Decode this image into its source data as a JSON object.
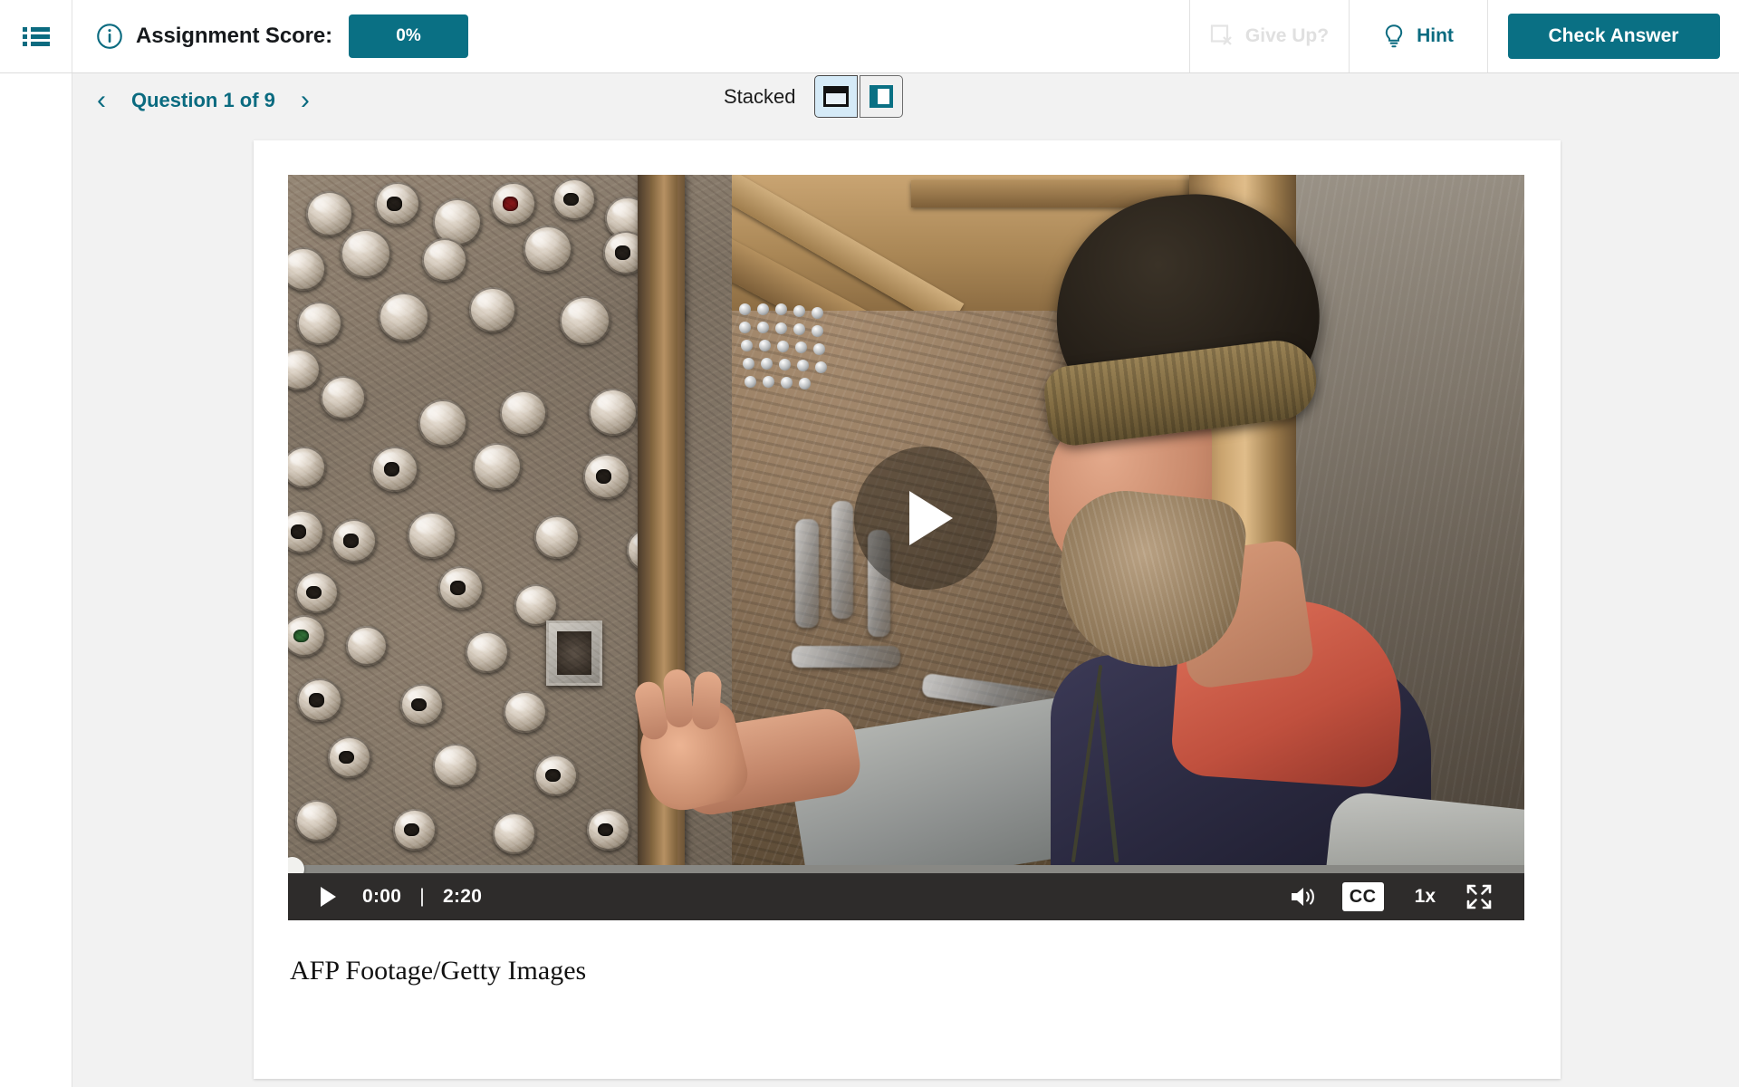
{
  "header": {
    "menu_icon": "list-icon",
    "info_icon": "info-circle-icon",
    "score_label": "Assignment Score:",
    "score_value": "0%",
    "give_up_label": "Give Up?",
    "give_up_icon": "square-x-icon",
    "hint_label": "Hint",
    "hint_icon": "lightbulb-icon",
    "check_answer_label": "Check Answer"
  },
  "nav": {
    "prev_icon": "chevron-left-icon",
    "next_icon": "chevron-right-icon",
    "question_label": "Question 1 of 9",
    "current_question": 1,
    "total_questions": 9
  },
  "layout": {
    "label": "Stacked",
    "option_stacked_icon": "layout-stacked-icon",
    "option_side_by_side_icon": "layout-side-by-side-icon",
    "selected": "stacked"
  },
  "video": {
    "play_overlay_icon": "play-triangle-icon",
    "play_icon": "play-icon",
    "current_time": "0:00",
    "time_separator": "|",
    "duration": "2:20",
    "volume_icon": "volume-high-icon",
    "cc_label": "CC",
    "speed_label": "1x",
    "fullscreen_icon": "fullscreen-expand-icon",
    "progress_percent": 0,
    "caption": "AFP Footage/Getty Images"
  },
  "colors": {
    "accent_teal": "#0a7084",
    "link_teal": "#0b6b80",
    "disabled_gray": "#dadada",
    "page_bg": "#f2f2f2",
    "card_bg": "#ffffff",
    "control_bar": "#2e2c2b",
    "seg_selected_bg": "#d5eaf7"
  }
}
